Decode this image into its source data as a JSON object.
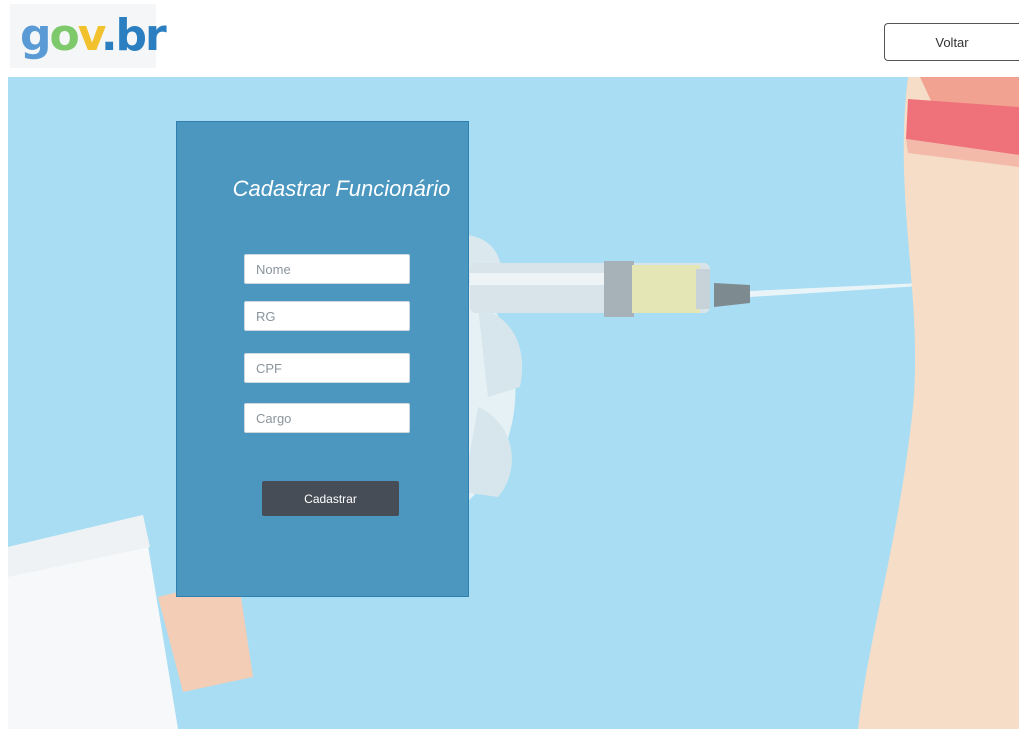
{
  "header": {
    "logo_text": "gov.br",
    "back_label": "Voltar"
  },
  "form": {
    "title": "Cadastrar Funcionário",
    "fields": [
      {
        "placeholder": "Nome",
        "value": ""
      },
      {
        "placeholder": "RG",
        "value": ""
      },
      {
        "placeholder": "CPF",
        "value": ""
      },
      {
        "placeholder": "Cargo",
        "value": ""
      }
    ],
    "submit_label": "Cadastrar"
  },
  "colors": {
    "background": "#a8ddf3",
    "form_panel": "#4b97c0",
    "submit_button": "#474d56",
    "logo_g": "#5b9bd5",
    "logo_o": "#7dc96b",
    "logo_v": "#f2c12e",
    "logo_br": "#2b7fc0"
  },
  "icons": [
    "gov-br-logo",
    "syringe-illustration"
  ]
}
